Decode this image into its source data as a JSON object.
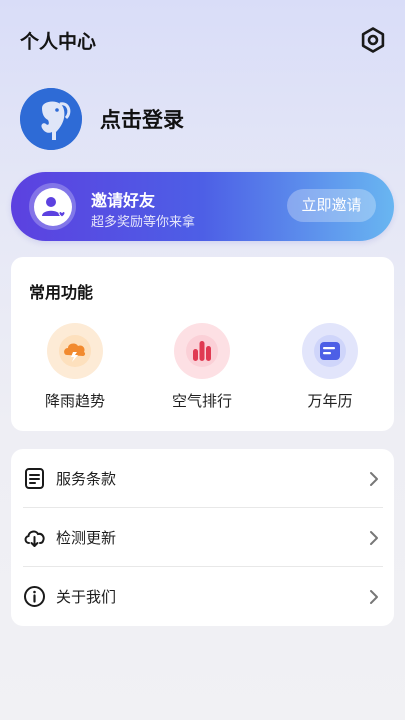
{
  "header": {
    "title": "个人中心",
    "settings_icon": "gear-icon"
  },
  "profile": {
    "login_label": "点击登录",
    "avatar_icon": "elephant-avatar"
  },
  "invite": {
    "title": "邀请好友",
    "subtitle": "超多奖励等你来拿",
    "button_label": "立即邀请",
    "icon": "user-heart-icon"
  },
  "functions": {
    "title": "常用功能",
    "items": [
      {
        "label": "降雨趋势",
        "icon": "cloud-lightning-icon",
        "color": "#f28a2e"
      },
      {
        "label": "空气排行",
        "icon": "bar-chart-icon",
        "color": "#e03a52"
      },
      {
        "label": "万年历",
        "icon": "calendar-icon",
        "color": "#4d5fe6"
      }
    ]
  },
  "menu": {
    "items": [
      {
        "label": "服务条款",
        "icon": "document-icon"
      },
      {
        "label": "检测更新",
        "icon": "cloud-download-icon"
      },
      {
        "label": "关于我们",
        "icon": "info-icon"
      }
    ]
  },
  "colors": {
    "accent": "#4d5fe6",
    "invite_gradient_start": "#5c41e0",
    "invite_gradient_end": "#69b6f1"
  }
}
